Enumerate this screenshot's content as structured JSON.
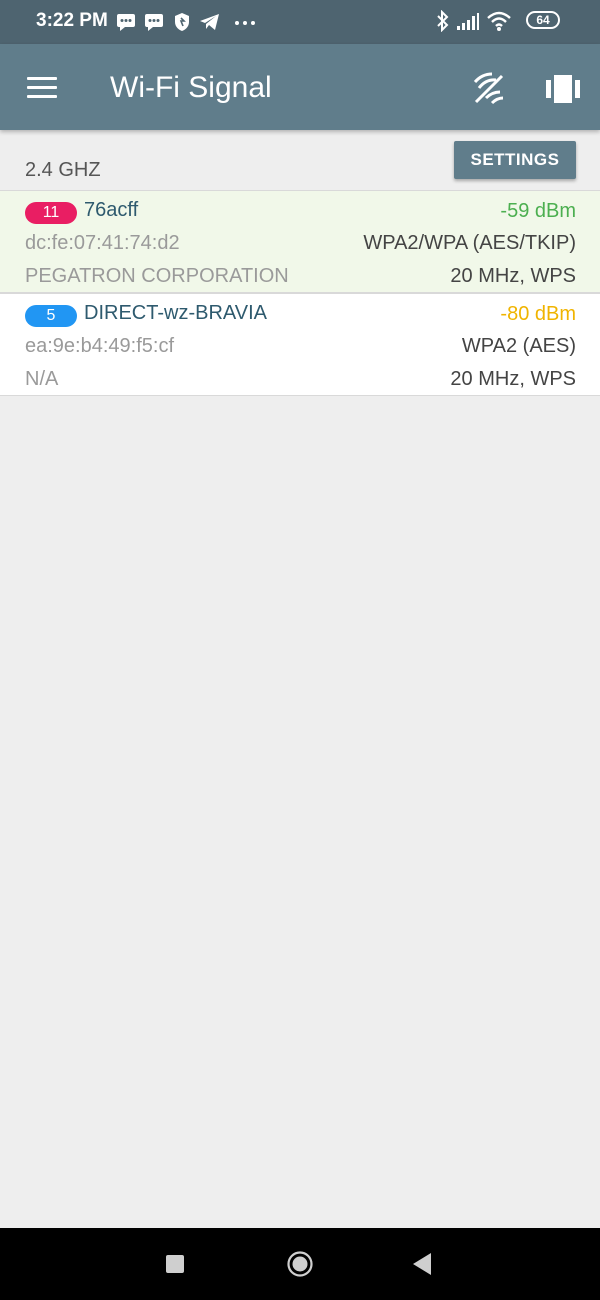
{
  "status_bar": {
    "time": "3:22 PM",
    "battery": "64",
    "left_icons": [
      "message-icon",
      "message-icon",
      "vpn-shield-icon",
      "telegram-icon",
      "more-dots-icon"
    ],
    "right_icons": [
      "bluetooth-icon",
      "cell-signal-icon",
      "wifi-icon",
      "battery-icon"
    ]
  },
  "app_bar": {
    "title": "Wi-Fi Signal",
    "menu_icon": "menu-icon",
    "actions": [
      "wifi-scan-icon",
      "view-toggle-icon"
    ]
  },
  "band": {
    "label": "2.4 GHZ",
    "settings_label": "SETTINGS"
  },
  "networks": [
    {
      "channel": "11",
      "ssid": "76acff",
      "signal": "-59 dBm",
      "bssid": "dc:fe:07:41:74:d2",
      "security": "WPA2/WPA (AES/TKIP)",
      "vendor": "PEGATRON CORPORATION",
      "width": "20 MHz, WPS",
      "badge_color": "#e91e63",
      "signal_color": "#4caf50"
    },
    {
      "channel": "5",
      "ssid": "DIRECT-wz-BRAVIA",
      "signal": "-80 dBm",
      "bssid": "ea:9e:b4:49:f5:cf",
      "security": "WPA2 (AES)",
      "vendor": "N/A",
      "width": "20 MHz, WPS",
      "badge_color": "#2196f3",
      "signal_color": "#f0b400"
    }
  ],
  "nav_bar": {
    "buttons": [
      "recent-apps-icon",
      "home-icon",
      "back-icon"
    ]
  }
}
